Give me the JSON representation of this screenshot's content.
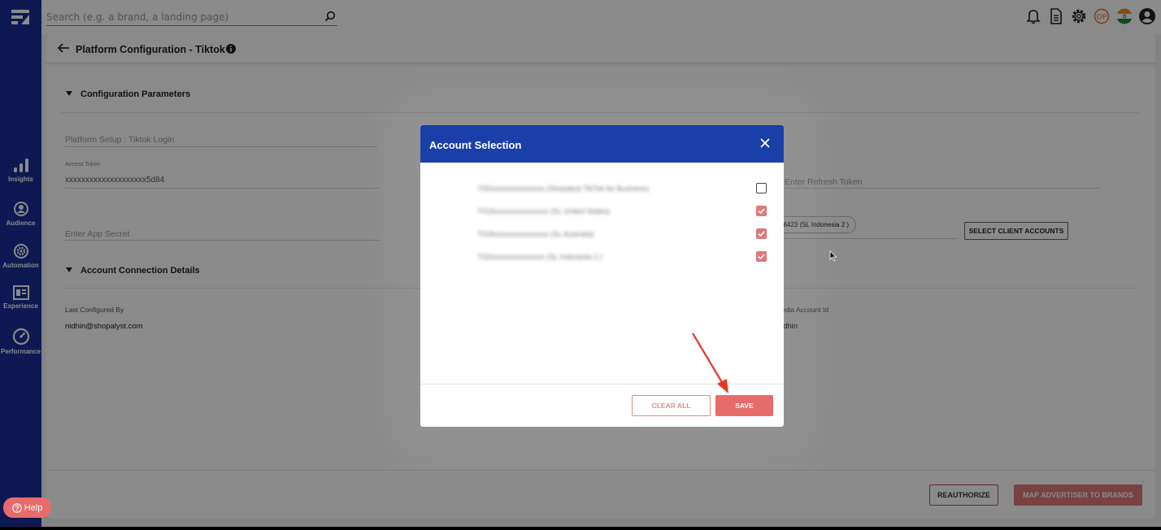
{
  "search": {
    "placeholder": "Search (e.g. a brand, a landing page)"
  },
  "sidebar": {
    "items": [
      {
        "label": "Insights",
        "icon": "bar-chart-icon"
      },
      {
        "label": "Audience",
        "icon": "audience-icon"
      },
      {
        "label": "Automation",
        "icon": "gear-icon"
      },
      {
        "label": "Experience",
        "icon": "layout-icon"
      },
      {
        "label": "Performance",
        "icon": "gauge-icon"
      }
    ]
  },
  "topbar": {
    "icons": [
      "bell-icon",
      "document-icon",
      "gear-icon",
      "user-initials-badge",
      "india-flag-icon",
      "account-icon"
    ],
    "initials": "OP"
  },
  "page": {
    "title": "Platform Configuration - Tiktok",
    "config_section": "Configuration Parameters",
    "platform_setup": "Platform Setup : Tiktok Login",
    "access_token_label": "Access Token",
    "access_token_value": "xxxxxxxxxxxxxxxxxxxx5d84",
    "refresh_token_placeholder": "Enter Refresh Token",
    "app_secret_placeholder": "Enter App Secret",
    "selected_chip": "96423 (SL Indonesia 2 )",
    "select_client_btn": "SELECT CLIENT ACCOUNTS",
    "connection_section": "Account Connection Details",
    "last_configured_label": "Last Configured By",
    "last_configured_value": "nidhin@shopalyst.com",
    "media_account_label": "edia Account Id",
    "media_account_value": "idhin",
    "reauthorize_btn": "REAUTHORIZE",
    "map_btn": "MAP ADVERTISER TO BRANDS"
  },
  "modal": {
    "title": "Account Selection",
    "accounts": [
      {
        "name": "7052xxxxxxxxxxxxxx (Shopalyst TikTok for Business)",
        "checked": false
      },
      {
        "name": "7019xxxxxxxxxxxxxxx (SL United States)",
        "checked": true
      },
      {
        "name": "7018xxxxxxxxxxxxxxx (SL Australia)",
        "checked": true
      },
      {
        "name": "7020xxxxxxxxxxxxxx (SL Indonesia 2 )",
        "checked": true
      }
    ],
    "clear_btn": "CLEAR ALL",
    "save_btn": "SAVE"
  },
  "help": {
    "label": "Help"
  }
}
